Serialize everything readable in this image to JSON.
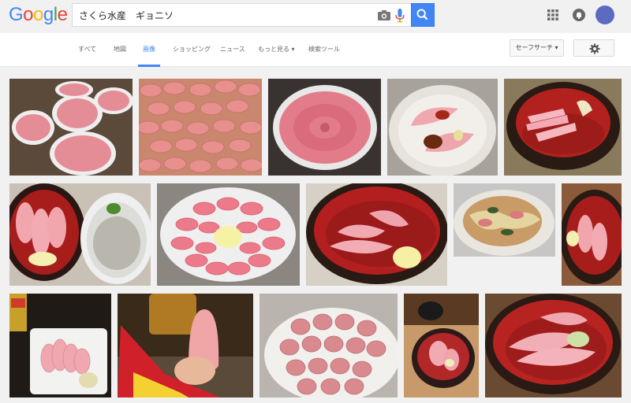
{
  "header": {
    "logo_letters": [
      {
        "ch": "G",
        "color": "#4285f4"
      },
      {
        "ch": "o",
        "color": "#ea4335"
      },
      {
        "ch": "o",
        "color": "#fbbc05"
      },
      {
        "ch": "g",
        "color": "#4285f4"
      },
      {
        "ch": "l",
        "color": "#34a853"
      },
      {
        "ch": "e",
        "color": "#ea4335"
      }
    ],
    "search_query": "さくら水産　ギョニソ"
  },
  "nav": {
    "tabs": [
      {
        "label": "すべて",
        "active": false
      },
      {
        "label": "地図",
        "active": false
      },
      {
        "label": "画像",
        "active": true
      },
      {
        "label": "ショッピング",
        "active": false
      },
      {
        "label": "ニュース",
        "active": false
      },
      {
        "label": "もっと見る ▾",
        "active": false
      },
      {
        "label": "検索ツール",
        "active": false
      }
    ],
    "safesearch_label": "セーフサーチ ▾"
  },
  "results": {
    "images": [
      {
        "subject": "fish-sausage-plates-on-newspaper"
      },
      {
        "subject": "fish-sausage-slices-flower-closeup"
      },
      {
        "subject": "fish-sausage-plate-flower"
      },
      {
        "subject": "fish-sausage-with-soy-and-ginger"
      },
      {
        "subject": "fish-sausage-in-red-bowl"
      },
      {
        "subject": "fish-sausage-and-shirasu"
      },
      {
        "subject": "fish-sausage-flower-with-mayo"
      },
      {
        "subject": "fish-sausage-bowl-with-mayo"
      },
      {
        "subject": "fish-sausage-stir-fry"
      },
      {
        "subject": "fish-sausage-small-bowl"
      },
      {
        "subject": "fish-sausage-white-plate"
      },
      {
        "subject": "fish-sausage-held-in-hand"
      },
      {
        "subject": "fish-sausage-slices-on-plate"
      },
      {
        "subject": "fish-sausage-dark-bowl"
      },
      {
        "subject": "fish-sausage-red-bowl-wasabi"
      }
    ]
  }
}
